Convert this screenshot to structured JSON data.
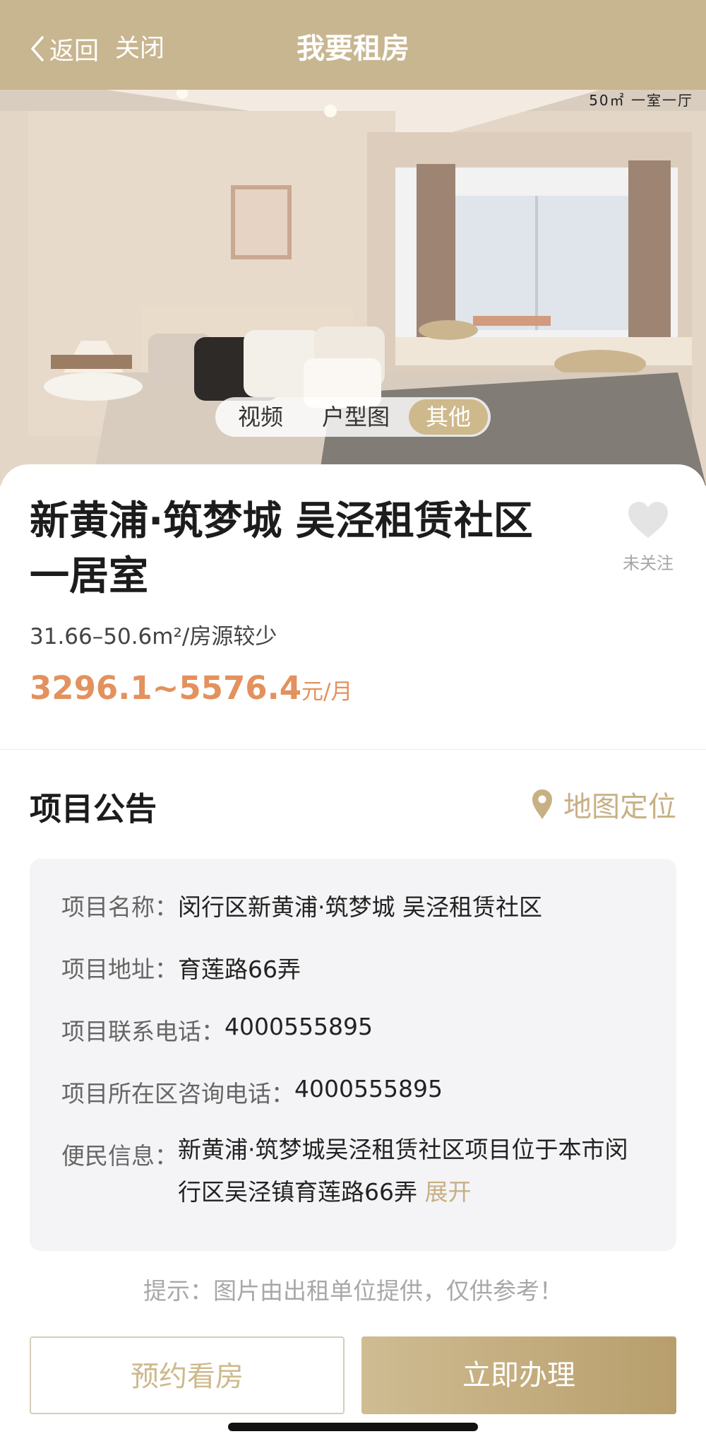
{
  "nav": {
    "back_label": "返回",
    "close_label": "关闭",
    "title": "我要租房",
    "bg_color": "#c8b690"
  },
  "hero": {
    "badge": "50㎡ 一室一厅",
    "tabs": [
      {
        "label": "视频",
        "selected": false
      },
      {
        "label": "户型图",
        "selected": false
      },
      {
        "label": "其他",
        "selected": true
      }
    ]
  },
  "listing": {
    "title": "新黄浦·筑梦城 吴泾租赁社区 一居室",
    "favorite_label": "未关注",
    "area_text": "31.66–50.6m²/房源较少",
    "price": "3296.1~5576.4",
    "price_unit": "元/月",
    "price_color": "#e3915d"
  },
  "announcement": {
    "title": "项目公告",
    "map_link": "地图定位",
    "rows": [
      {
        "key": "项目名称：",
        "value": "闵行区新黄浦·筑梦城 吴泾租赁社区"
      },
      {
        "key": "项目地址：",
        "value": "育莲路66弄"
      },
      {
        "key": "项目联系电话：",
        "value": "4000555895"
      },
      {
        "key": "项目所在区咨询电话：",
        "value": "4000555895"
      },
      {
        "key": "便民信息：",
        "value": "新黄浦·筑梦城吴泾租赁社区项目位于本市闵行区吴泾镇育莲路66弄"
      }
    ],
    "expand_label": "展开"
  },
  "tip": "提示：图片由出租单位提供，仅供参考！",
  "actions": {
    "book_label": "预约看房",
    "apply_label": "立即办理",
    "accent_color": "#cdb98c"
  }
}
